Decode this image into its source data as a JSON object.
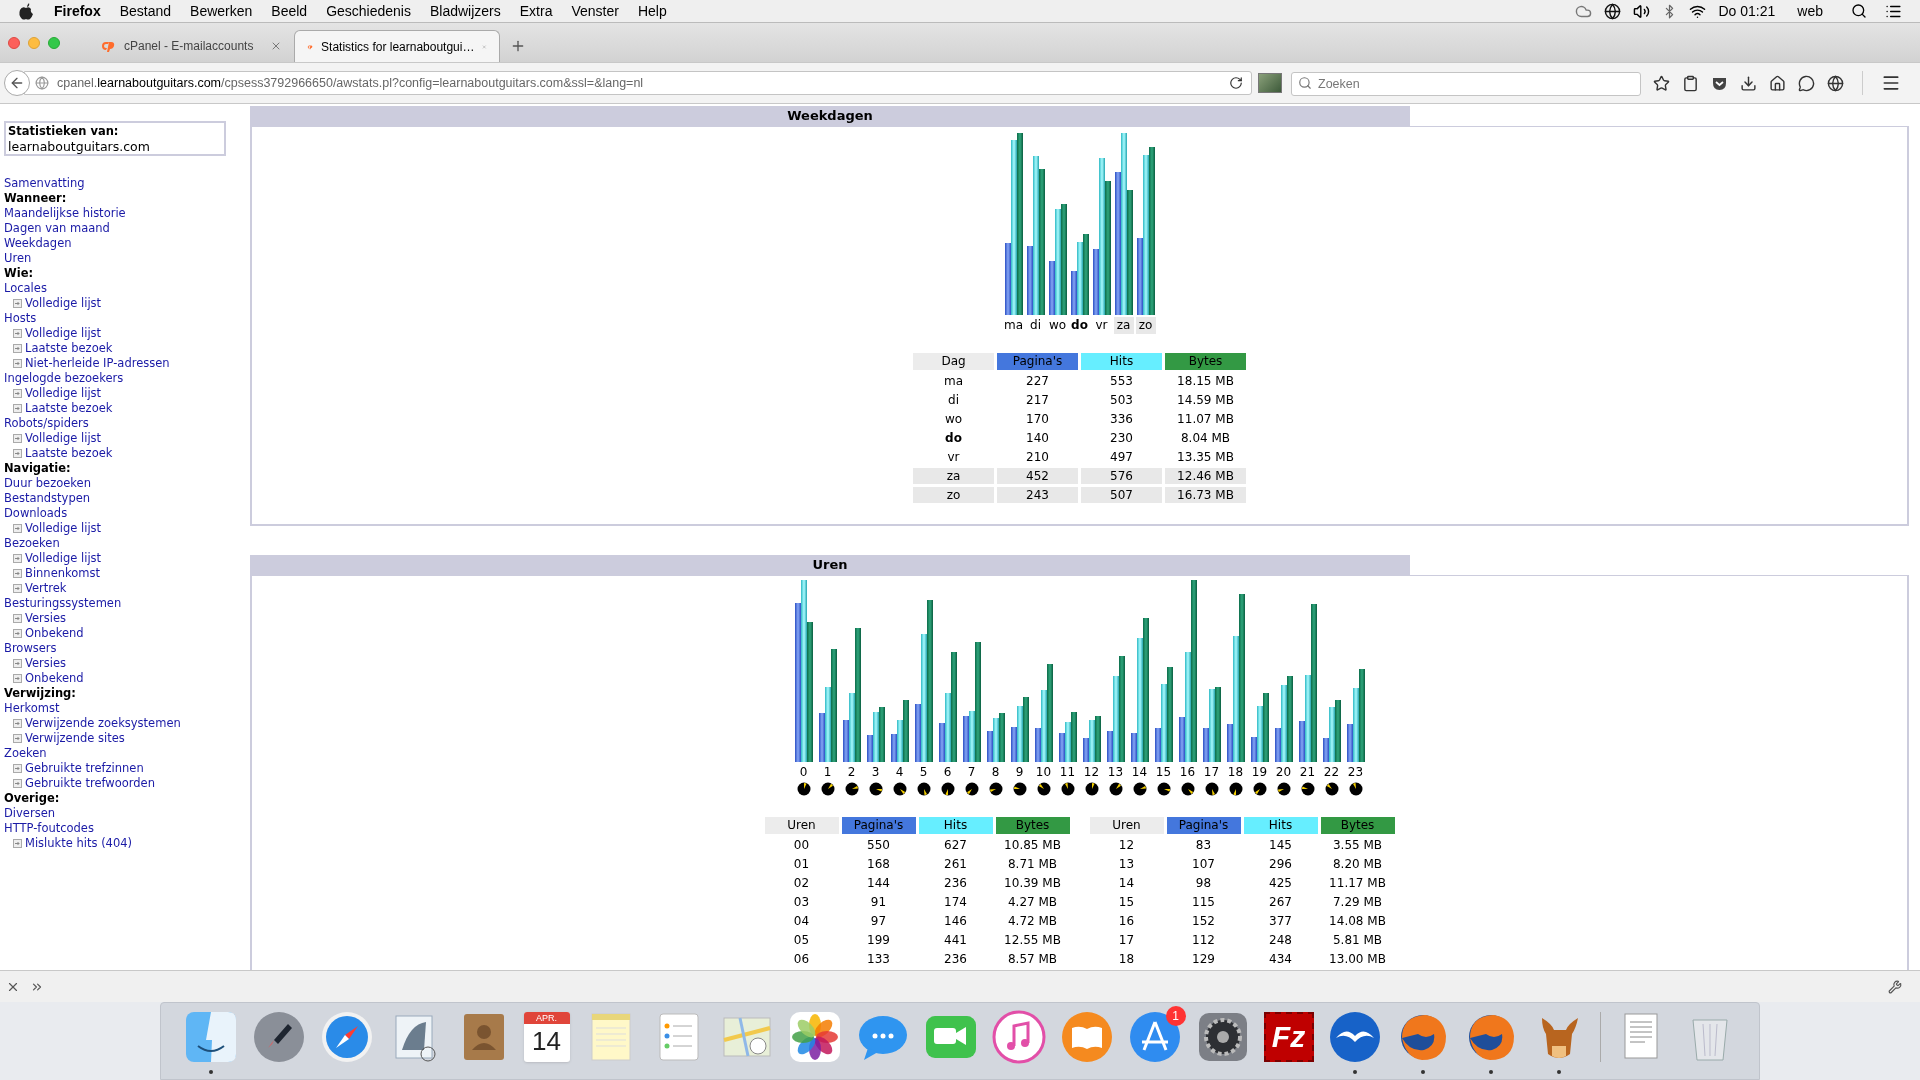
{
  "menu_bar": {
    "app": "Firefox",
    "menus": [
      "Bestand",
      "Bewerken",
      "Beeld",
      "Geschiedenis",
      "Bladwijzers",
      "Extra",
      "Venster",
      "Help"
    ],
    "clock": "Do 01:21",
    "user": "web"
  },
  "tabs": [
    {
      "label": "cPanel - E-mailaccounts",
      "selected": false
    },
    {
      "label": "Statistics for learnaboutgui…",
      "selected": true
    }
  ],
  "address_bar": {
    "url": "cpanel.**learnaboutguitars.com**/cpsess3792966650/awstats.pl?config=learnaboutguitars.com&ssl=&lang=nl"
  },
  "search": {
    "placeholder": "Zoeken"
  },
  "sidebar": {
    "stats_label": "Statistieken van:",
    "domain": "learnaboutguitars.com",
    "items": [
      {
        "kind": "link",
        "label": "Samenvatting"
      },
      {
        "kind": "heading",
        "label": "Wanneer:"
      },
      {
        "kind": "link",
        "label": "Maandelijkse historie"
      },
      {
        "kind": "link",
        "label": "Dagen van maand"
      },
      {
        "kind": "link",
        "label": "Weekdagen"
      },
      {
        "kind": "link",
        "label": "Uren"
      },
      {
        "kind": "heading",
        "label": "Wie:"
      },
      {
        "kind": "link",
        "label": "Locales",
        "children": [
          {
            "label": "Volledige lijst"
          }
        ]
      },
      {
        "kind": "link",
        "label": "Hosts",
        "children": [
          {
            "label": "Volledige lijst"
          },
          {
            "label": "Laatste bezoek"
          },
          {
            "label": "Niet-herleide IP-adressen"
          }
        ]
      },
      {
        "kind": "link",
        "label": "Ingelogde bezoekers",
        "children": [
          {
            "label": "Volledige lijst"
          },
          {
            "label": "Laatste bezoek"
          }
        ]
      },
      {
        "kind": "link",
        "label": "Robots/spiders",
        "children": [
          {
            "label": "Volledige lijst"
          },
          {
            "label": "Laatste bezoek"
          }
        ]
      },
      {
        "kind": "heading",
        "label": "Navigatie:"
      },
      {
        "kind": "link",
        "label": "Duur bezoeken"
      },
      {
        "kind": "link",
        "label": "Bestandstypen"
      },
      {
        "kind": "link",
        "label": "Downloads",
        "children": [
          {
            "label": "Volledige lijst"
          }
        ]
      },
      {
        "kind": "link",
        "label": "Bezoeken",
        "children": [
          {
            "label": "Volledige lijst"
          },
          {
            "label": "Binnenkomst"
          },
          {
            "label": "Vertrek"
          }
        ]
      },
      {
        "kind": "link",
        "label": "Besturingssystemen",
        "children": [
          {
            "label": "Versies"
          },
          {
            "label": "Onbekend"
          }
        ]
      },
      {
        "kind": "link",
        "label": "Browsers",
        "children": [
          {
            "label": "Versies"
          },
          {
            "label": "Onbekend"
          }
        ]
      },
      {
        "kind": "heading",
        "label": "Verwijzing:"
      },
      {
        "kind": "link",
        "label": "Herkomst",
        "children": [
          {
            "label": "Verwijzende zoeksystemen"
          },
          {
            "label": "Verwijzende sites"
          }
        ]
      },
      {
        "kind": "link",
        "label": "Zoeken",
        "children": [
          {
            "label": "Gebruikte trefzinnen"
          },
          {
            "label": "Gebruikte trefwoorden"
          }
        ]
      },
      {
        "kind": "heading",
        "label": "Overige:"
      },
      {
        "kind": "link",
        "label": "Diversen"
      },
      {
        "kind": "link",
        "label": "HTTP-foutcodes",
        "children": [
          {
            "label": "Mislukte hits (404)"
          }
        ]
      }
    ]
  },
  "weekdagen": {
    "title": "Weekdagen",
    "chart_labels": [
      {
        "label": "ma",
        "today": false,
        "weekend": false
      },
      {
        "label": "di",
        "today": false,
        "weekend": false
      },
      {
        "label": "wo",
        "today": false,
        "weekend": false
      },
      {
        "label": "do",
        "today": true,
        "weekend": false
      },
      {
        "label": "vr",
        "today": false,
        "weekend": false
      },
      {
        "label": "za",
        "today": false,
        "weekend": true
      },
      {
        "label": "zo",
        "today": false,
        "weekend": true
      }
    ],
    "columns": [
      "Dag",
      "Pagina's",
      "Hits",
      "Bytes"
    ],
    "rows": [
      {
        "day": "ma",
        "pages": "227",
        "hits": "553",
        "bytes": "18.15 MB",
        "today": false,
        "weekend": false
      },
      {
        "day": "di",
        "pages": "217",
        "hits": "503",
        "bytes": "14.59 MB",
        "today": false,
        "weekend": false
      },
      {
        "day": "wo",
        "pages": "170",
        "hits": "336",
        "bytes": "11.07 MB",
        "today": false,
        "weekend": false
      },
      {
        "day": "do",
        "pages": "140",
        "hits": "230",
        "bytes": "8.04 MB",
        "today": true,
        "weekend": false
      },
      {
        "day": "vr",
        "pages": "210",
        "hits": "497",
        "bytes": "13.35 MB",
        "today": false,
        "weekend": false
      },
      {
        "day": "za",
        "pages": "452",
        "hits": "576",
        "bytes": "12.46 MB",
        "today": false,
        "weekend": true
      },
      {
        "day": "zo",
        "pages": "243",
        "hits": "507",
        "bytes": "16.73 MB",
        "today": false,
        "weekend": true
      }
    ]
  },
  "uren": {
    "title": "Uren",
    "hours": [
      "0",
      "1",
      "2",
      "3",
      "4",
      "5",
      "6",
      "7",
      "8",
      "9",
      "10",
      "11",
      "12",
      "13",
      "14",
      "15",
      "16",
      "17",
      "18",
      "19",
      "20",
      "21",
      "22",
      "23"
    ],
    "tables": [
      {
        "columns": [
          "Uren",
          "Pagina's",
          "Hits",
          "Bytes"
        ],
        "rows": [
          {
            "hour": "00",
            "pages": "550",
            "hits": "627",
            "bytes": "10.85 MB"
          },
          {
            "hour": "01",
            "pages": "168",
            "hits": "261",
            "bytes": "8.71 MB"
          },
          {
            "hour": "02",
            "pages": "144",
            "hits": "236",
            "bytes": "10.39 MB"
          },
          {
            "hour": "03",
            "pages": "91",
            "hits": "174",
            "bytes": "4.27 MB"
          },
          {
            "hour": "04",
            "pages": "97",
            "hits": "146",
            "bytes": "4.72 MB"
          },
          {
            "hour": "05",
            "pages": "199",
            "hits": "441",
            "bytes": "12.55 MB"
          },
          {
            "hour": "06",
            "pages": "133",
            "hits": "236",
            "bytes": "8.57 MB"
          }
        ]
      },
      {
        "columns": [
          "Uren",
          "Pagina's",
          "Hits",
          "Bytes"
        ],
        "rows": [
          {
            "hour": "12",
            "pages": "83",
            "hits": "145",
            "bytes": "3.55 MB"
          },
          {
            "hour": "13",
            "pages": "107",
            "hits": "296",
            "bytes": "8.20 MB"
          },
          {
            "hour": "14",
            "pages": "98",
            "hits": "425",
            "bytes": "11.17 MB"
          },
          {
            "hour": "15",
            "pages": "115",
            "hits": "267",
            "bytes": "7.29 MB"
          },
          {
            "hour": "16",
            "pages": "152",
            "hits": "377",
            "bytes": "14.08 MB"
          },
          {
            "hour": "17",
            "pages": "112",
            "hits": "248",
            "bytes": "5.81 MB"
          },
          {
            "hour": "18",
            "pages": "129",
            "hits": "434",
            "bytes": "13.00 MB"
          }
        ]
      }
    ]
  },
  "dock": {
    "apps": [
      {
        "kind": "finder",
        "running": true
      },
      {
        "kind": "launchpad",
        "running": false
      },
      {
        "kind": "safari",
        "running": false
      },
      {
        "kind": "mail",
        "running": false
      },
      {
        "kind": "contacts",
        "running": false
      },
      {
        "kind": "calendar",
        "month": "APR.",
        "day": "14",
        "running": false
      },
      {
        "kind": "notes",
        "running": false
      },
      {
        "kind": "reminders",
        "running": false
      },
      {
        "kind": "maps",
        "running": false
      },
      {
        "kind": "photos",
        "running": false
      },
      {
        "kind": "messages",
        "running": false
      },
      {
        "kind": "facetime",
        "running": false
      },
      {
        "kind": "music",
        "running": false
      },
      {
        "kind": "books",
        "running": false
      },
      {
        "kind": "appstore",
        "badge": "1",
        "running": false
      },
      {
        "kind": "settings",
        "running": false
      },
      {
        "kind": "ftp",
        "text": "Fz",
        "running": false
      },
      {
        "kind": "office",
        "running": true
      },
      {
        "kind": "firefox",
        "running": true
      },
      {
        "kind": "firefox",
        "running": true
      },
      {
        "kind": "gnu",
        "running": true
      },
      {
        "kind": "separator"
      },
      {
        "kind": "document",
        "running": false
      },
      {
        "kind": "trash",
        "running": false
      }
    ]
  }
}
